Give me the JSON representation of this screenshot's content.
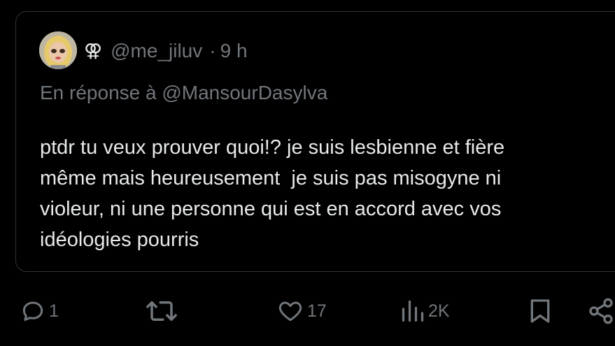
{
  "post": {
    "user_symbol": "⚢",
    "handle": "@me_jiluv",
    "separator": "·",
    "time": "9 h",
    "reply_to": "En réponse à @MansourDasylva",
    "text_lines": [
      "ptdr tu veux prouver quoi!? je suis lesbienne et fière",
      "même mais heureusement  je suis pas misogyne ni",
      "violeur, ni une personne qui est en accord avec vos",
      "idéologies pourris"
    ]
  },
  "actions": {
    "reply_count": "1",
    "repost_count": "",
    "like_count": "17",
    "views_count": "2K"
  },
  "icons": {
    "reply": "reply-icon",
    "repost": "repost-icon",
    "like": "heart-icon",
    "views": "views-icon",
    "bookmark": "bookmark-icon",
    "share": "share-icon"
  },
  "colors": {
    "background": "#000000",
    "border": "#2f3336",
    "text_primary": "#e7e9ea",
    "text_secondary": "#71767b"
  }
}
